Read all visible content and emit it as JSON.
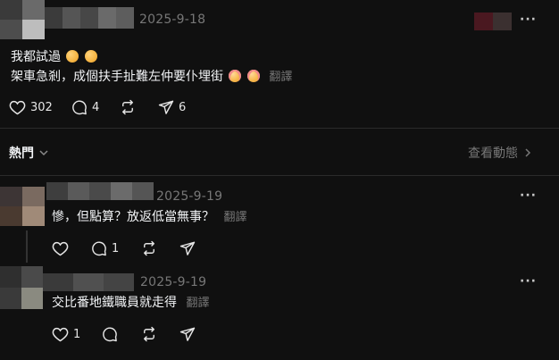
{
  "post": {
    "date": "2025-9-18",
    "more_label": "···",
    "lines": [
      "我都試過",
      "架車急剎，成個扶手扯難左仲要仆埋街"
    ],
    "translate_label": "翻譯",
    "likes": "302",
    "comments": "4",
    "shares": "6",
    "emoji_line1": [
      "hug-emoji",
      "hug-emoji"
    ],
    "emoji_line2": [
      "blush-emoji",
      "blush-emoji"
    ]
  },
  "sort": {
    "label": "熱門",
    "activity_label": "查看動態"
  },
  "replies": [
    {
      "date": "2025-9-19",
      "text": "慘，但點算？放返低當無事？",
      "translate_label": "翻譯",
      "more_label": "···",
      "likes": "",
      "comments": "1"
    },
    {
      "date": "2025-9-19",
      "text": "交比番地鐵職員就走得",
      "translate_label": "翻譯",
      "more_label": "···",
      "likes": "1",
      "comments": ""
    }
  ],
  "colors": {
    "background": "#101010",
    "text": "#f3f5f7",
    "muted": "#777777",
    "divider": "#2b2b2b"
  }
}
